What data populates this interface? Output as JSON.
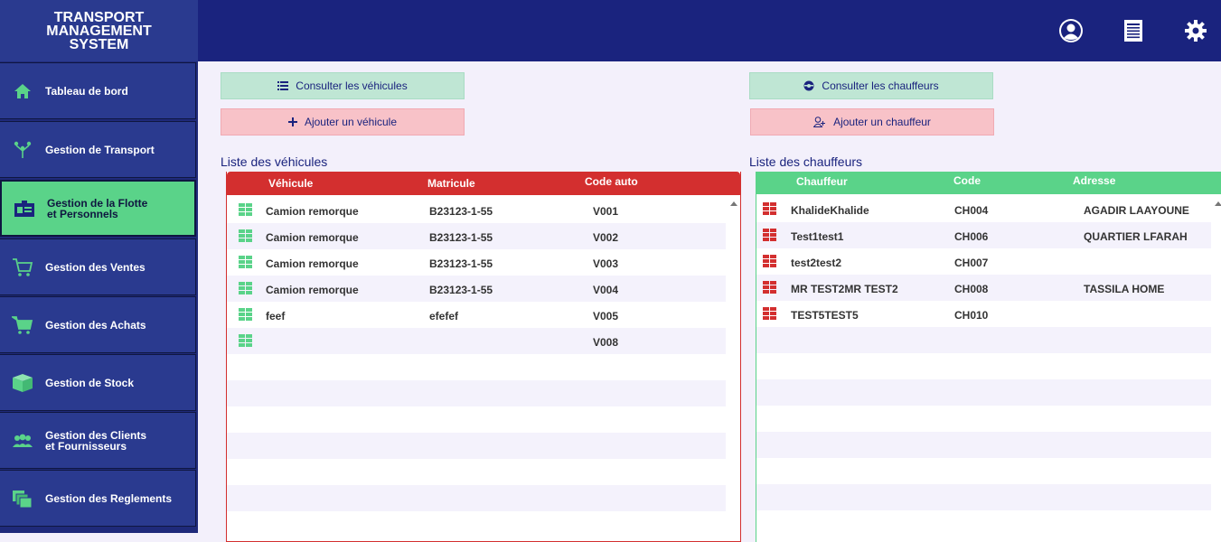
{
  "app": {
    "title_line1": "TRANSPORT",
    "title_line2": "MANAGEMENT",
    "title_line3": "SYSTEM"
  },
  "sidebar": {
    "items": [
      {
        "label1": "Tableau de bord",
        "label2": "",
        "icon": "home-icon"
      },
      {
        "label1": "Gestion de Transport",
        "label2": "",
        "icon": "network-icon"
      },
      {
        "label1": "Gestion de la Flotte",
        "label2": "et Personnels",
        "icon": "id-card-icon",
        "active": true
      },
      {
        "label1": "Gestion des Ventes",
        "label2": "",
        "icon": "cart-icon"
      },
      {
        "label1": "Gestion des Achats",
        "label2": "",
        "icon": "cart-full-icon"
      },
      {
        "label1": "Gestion de Stock",
        "label2": "",
        "icon": "box-icon"
      },
      {
        "label1": "Gestion des Clients",
        "label2": "et Fournisseurs",
        "icon": "users-icon"
      },
      {
        "label1": "Gestion des Reglements",
        "label2": "",
        "icon": "documents-icon"
      }
    ]
  },
  "toolbar": {
    "consult_vehicles": "Consulter les véhicules",
    "add_vehicle": "Ajouter un véhicule",
    "consult_drivers": "Consulter les chauffeurs",
    "add_driver": "Ajouter un chauffeur"
  },
  "vehicles": {
    "title": "Liste des véhicules",
    "columns": [
      "Véhicule",
      "Matricule",
      "Code auto"
    ],
    "rows": [
      [
        "Camion remorque",
        "B23123-1-55",
        "V001"
      ],
      [
        "Camion remorque",
        "B23123-1-55",
        "V002"
      ],
      [
        "Camion remorque",
        "B23123-1-55",
        "V003"
      ],
      [
        "Camion remorque",
        "B23123-1-55",
        "V004"
      ],
      [
        "feef",
        "efefef",
        "V005"
      ],
      [
        "",
        "",
        "V008"
      ]
    ]
  },
  "drivers": {
    "title": "Liste des chauffeurs",
    "columns": [
      "Chauffeur",
      "Code",
      "Adresse"
    ],
    "rows": [
      [
        "KhalideKhalide",
        "CH004",
        "AGADIR LAAYOUNE"
      ],
      [
        "Test1test1",
        "CH006",
        "QUARTIER LFARAH"
      ],
      [
        "test2test2",
        "CH007",
        ""
      ],
      [
        "MR TEST2MR TEST2",
        "CH008",
        "TASSILA HOME"
      ],
      [
        "TEST5TEST5",
        "CH010",
        ""
      ]
    ]
  },
  "colors": {
    "accent_green": "#5ad389",
    "accent_red": "#d32f2f",
    "navy": "#1a237e"
  }
}
